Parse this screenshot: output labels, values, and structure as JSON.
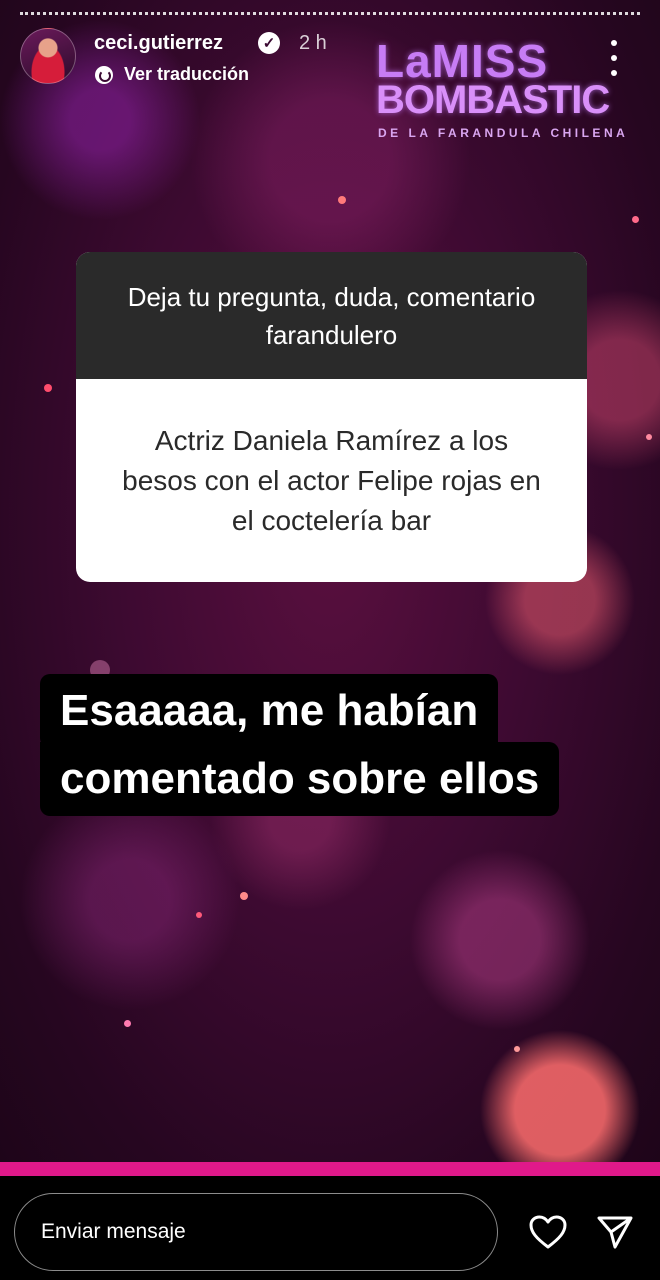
{
  "header": {
    "username": "ceci.gutierrez",
    "verified_icon": "verified-badge-icon",
    "time": "2 h",
    "translate_label": "Ver traducción"
  },
  "logo": {
    "line1": "LaMISS",
    "line2": "BOMBASTIC",
    "line3": "DE LA FARANDULA CHILENA"
  },
  "question": {
    "prompt": "Deja tu pregunta, duda, comentario farandulero",
    "answer": "Actriz Daniela Ramírez a los besos con el actor Felipe rojas en el coctelería bar"
  },
  "caption": {
    "line1": "Esaaaaa, me habían",
    "line2": "comentado sobre ellos"
  },
  "reply": {
    "placeholder": "Enviar mensaje"
  },
  "colors": {
    "accent": "#e0198a",
    "logo": "#c77cf5",
    "background": "#3d0a31"
  }
}
